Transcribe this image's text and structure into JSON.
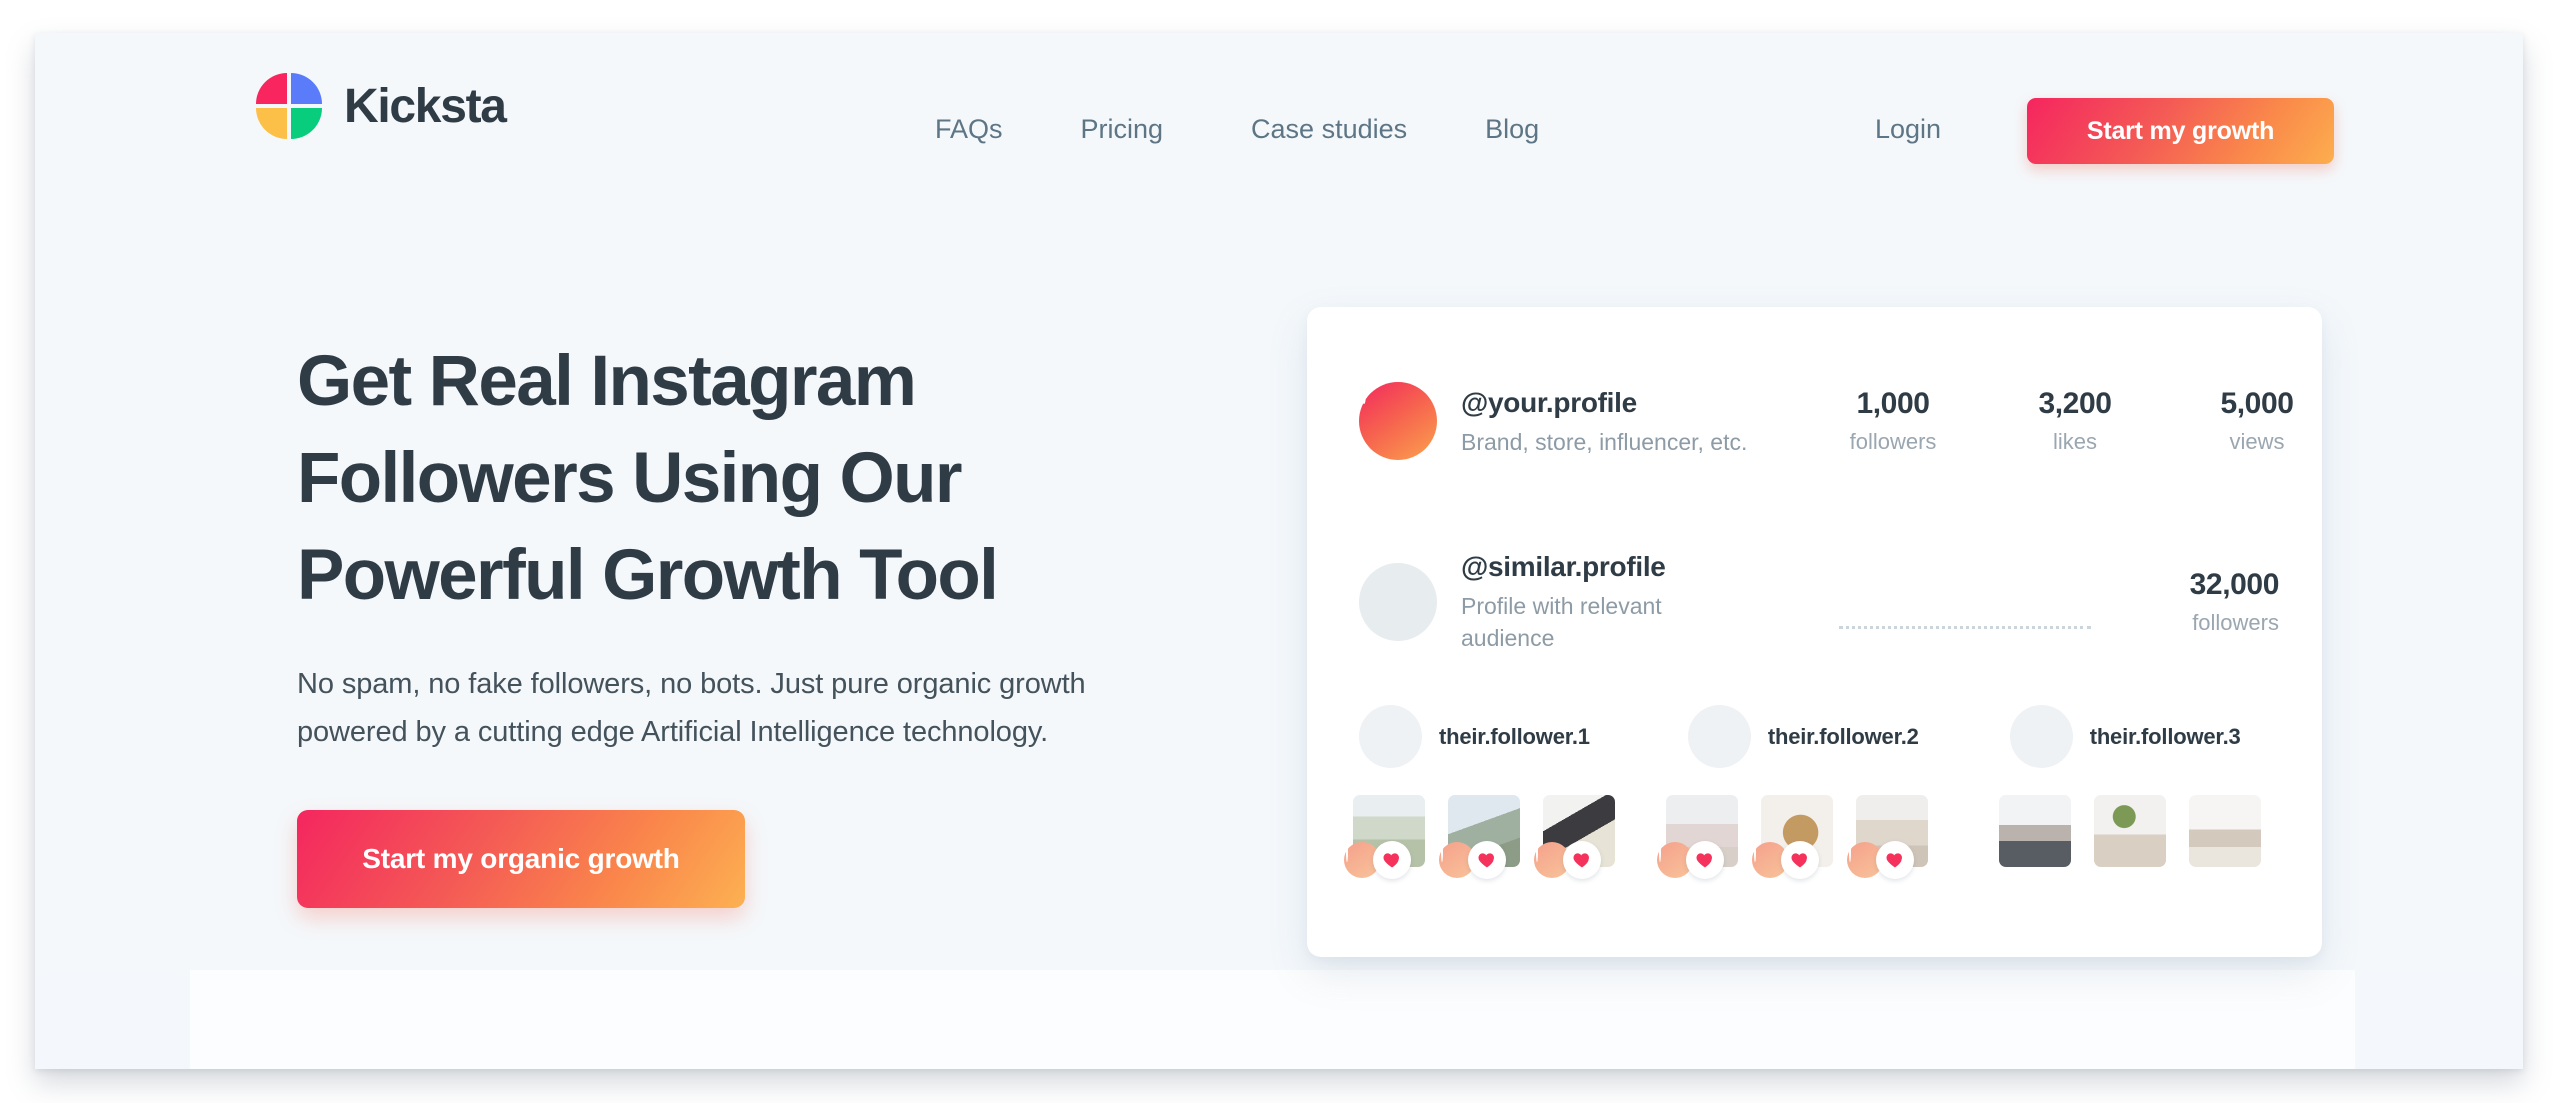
{
  "brand": {
    "name": "Kicksta",
    "logo_colors": {
      "top_left": "#f8255f",
      "top_right": "#5b7cfa",
      "bottom_left": "#fcc049",
      "bottom_right": "#08cd7d"
    }
  },
  "header": {
    "nav": [
      {
        "label": "FAQs"
      },
      {
        "label": "Pricing"
      },
      {
        "label": "Case studies"
      },
      {
        "label": "Blog"
      }
    ],
    "login_label": "Login",
    "cta_label": "Start my growth",
    "cta_gradient": [
      "#f5255f",
      "#fcae4e"
    ]
  },
  "hero": {
    "title": "Get Real Instagram Followers Using Our Powerful Growth Tool",
    "subtitle": "No spam, no fake followers, no bots. Just pure organic growth powered by a cutting edge Artificial Intelligence technology.",
    "cta_label": "Start my organic growth",
    "title_color": "#2f3c46",
    "background_color": "#f4f8fb"
  },
  "card": {
    "your_profile": {
      "handle": "@your.profile",
      "description": "Brand, store, influencer, etc.",
      "stats": [
        {
          "value": "1,000",
          "label": "followers"
        },
        {
          "value": "3,200",
          "label": "likes"
        },
        {
          "value": "5,000",
          "label": "views"
        }
      ]
    },
    "similar_profile": {
      "handle": "@similar.profile",
      "description_line1": "Profile with relevant",
      "description_line2": "audience",
      "stat": {
        "value": "32,000",
        "label": "followers"
      }
    },
    "followers": [
      {
        "name": "their.follower.1"
      },
      {
        "name": "their.follower.2"
      },
      {
        "name": "their.follower.3"
      }
    ],
    "photo_groups": [
      {
        "photos": 3,
        "liked": true
      },
      {
        "photos": 3,
        "liked": true
      },
      {
        "photos": 3,
        "liked": false
      }
    ],
    "heart_color": "#f5325b",
    "background_color": "#ffffff"
  }
}
